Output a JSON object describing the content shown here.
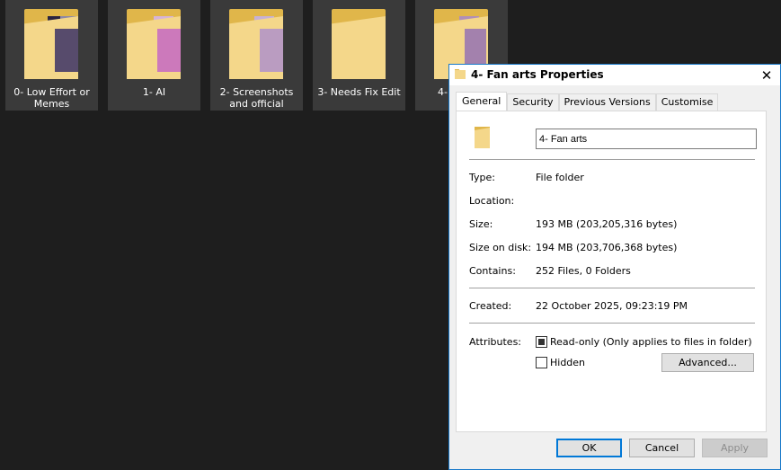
{
  "folders": [
    {
      "label": "0- Low Effort or Memes"
    },
    {
      "label": "1- AI"
    },
    {
      "label": "2- Screenshots and official"
    },
    {
      "label": "3- Needs Fix Edit"
    },
    {
      "label": "4-"
    }
  ],
  "dialog": {
    "title": "4- Fan arts Properties",
    "close_glyph": "✕",
    "tabs": [
      "General",
      "Security",
      "Previous Versions",
      "Customise"
    ],
    "active_tab": "General",
    "name_value": "4- Fan arts",
    "properties": {
      "type_label": "Type:",
      "type_value": "File folder",
      "location_label": "Location:",
      "location_value": "",
      "size_label": "Size:",
      "size_value": "193 MB (203,205,316 bytes)",
      "size_on_disk_label": "Size on disk:",
      "size_on_disk_value": "194 MB (203,706,368 bytes)",
      "contains_label": "Contains:",
      "contains_value": "252 Files, 0 Folders",
      "created_label": "Created:",
      "created_value": "22 October 2025, 09:23:19 PM",
      "attributes_label": "Attributes:",
      "readonly_label": "Read-only (Only applies to files in folder)",
      "hidden_label": "Hidden",
      "advanced_label": "Advanced..."
    },
    "buttons": {
      "ok": "OK",
      "cancel": "Cancel",
      "apply": "Apply"
    }
  },
  "colors": {
    "background": "#1e1e1e",
    "tile": "#3a3a3a",
    "folder_yellow": "#f4d78a",
    "accent": "#0078d7"
  }
}
